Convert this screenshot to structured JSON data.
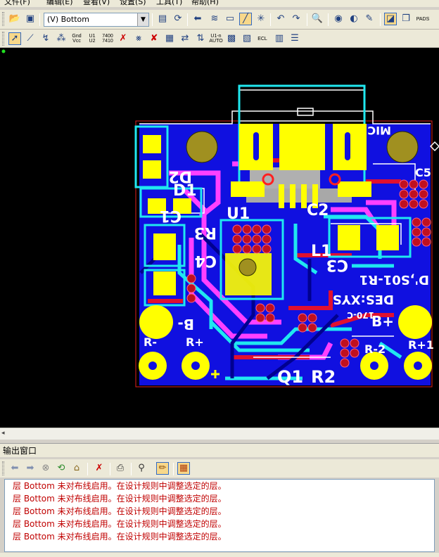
{
  "menu": [
    "文件(F)",
    "编辑(E)",
    "查看(V)",
    "设置(S)",
    "工具(T)",
    "帮助(H)"
  ],
  "toolbar": {
    "layer_select_value": "(V) Bottom",
    "gnd_label_top": "Gnd",
    "gnd_label_bottom": "Vcc",
    "u_label_top": "U1",
    "u_label_bottom": "U2",
    "num_label_top": "7400",
    "num_label_bottom": "7410",
    "route_label": "U1-n",
    "auto_label": "AUTO",
    "ecl_label": "ECL",
    "pads_label": "PADS"
  },
  "pcb": {
    "labels": {
      "d2": "D2",
      "d1": "D1",
      "c1": "C1",
      "u1": "U1",
      "c2": "C2",
      "l1": "L1",
      "c5": "C5",
      "mic": "MIC",
      "r3": "R3",
      "c4": "C4",
      "c3": "C3",
      "d_s01": "D',S01-R1",
      "des": "DES:XYS",
      "nums": "170-C",
      "b_minus": "B-",
      "b_plus": "B+",
      "r_minus": "R-",
      "r_plus": "R+",
      "r2_neg": "R-2",
      "r1_plus": "R+1",
      "q1": "Q1",
      "r2": "R2"
    }
  },
  "output": {
    "title": "输出窗口",
    "messages": [
      "层 Bottom 未对布线启用。在设计规则中调整选定的层。",
      "层 Bottom 未对布线启用。在设计规则中调整选定的层。",
      "层 Bottom 未对布线启用。在设计规则中调整选定的层。",
      "层 Bottom 未对布线启用。在设计规则中调整选定的层。",
      "层 Bottom 未对布线启用。在设计规则中调整选定的层。"
    ]
  },
  "colors": {
    "board_blue": "#1010e0",
    "pad_yellow": "#ffff00",
    "trace_cyan": "#20e8f0",
    "trace_pink": "#ff40ff",
    "via_red": "#e00030",
    "board_outline": "#e02020",
    "message_red": "#c00000"
  }
}
